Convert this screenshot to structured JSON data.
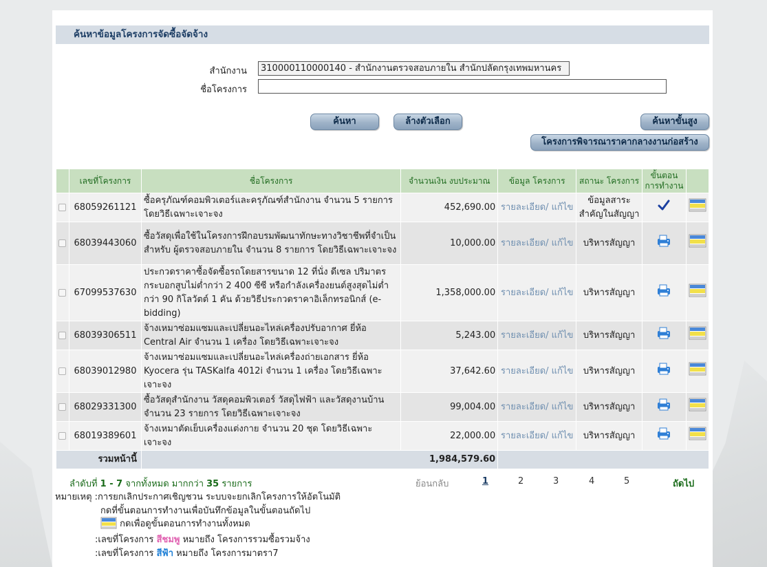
{
  "header": {
    "title": "ค้นหาข้อมูลโครงการจัดซื้อจัดจ้าง"
  },
  "form": {
    "agency_label": "สำนักงาน",
    "agency_value": "310000110000140 - สำนักงานตรวจสอบภายใน สำนักปลัดกรุงเทพมหานคร",
    "project_name_label": "ชื่อโครงการ",
    "project_name_value": ""
  },
  "buttons": {
    "search": "ค้นหา",
    "clear": "ล้างตัวเลือก",
    "advanced": "ค้นหาขั้นสูง",
    "construction": "โครงการพิจารณาราคากลางงานก่อสร้าง"
  },
  "table": {
    "headers": {
      "project_no": "เลขที่โครงการ",
      "project_name": "ชื่อโครงการ",
      "budget": "จำนวนเงิน งบประมาณ",
      "info": "ข้อมูล โครงการ",
      "status": "สถานะ โครงการ",
      "step": "ขั้นตอน การทำงาน"
    },
    "rows": [
      {
        "no": "68059261121",
        "name": "ซื้อครุภัณฑ์คอมพิวเตอร์และครุภัณฑ์สำนักงาน จำนวน 5 รายการ โดยวิธีเฉพาะเจาะจง",
        "budget": "452,690.00",
        "info": "รายละเอียด/ แก้ไข",
        "status": "ข้อมูลสาระ สำคัญในสัญญา",
        "step_icon": "checkmark-icon"
      },
      {
        "no": "68039443060",
        "name": "ซื้อวัสดุเพื่อใช้ในโครงการฝึกอบรมพัฒนาทักษะทางวิชาชีพที่จำเป็นสำหรับ ผู้ตรวจสอบภายใน จำนวน 8 รายการ โดยวิธีเฉพาะเจาะจง",
        "budget": "10,000.00",
        "info": "รายละเอียด/ แก้ไข",
        "status": "บริหารสัญญา",
        "step_icon": "printer-icon"
      },
      {
        "no": "67099537630",
        "name": "ประกวดราคาซื้อจัดซื้อรถโดยสารขนาด 12 ที่นั่ง ดีเซล ปริมาตรกระบอกสูบไม่ต่ำกว่า 2 400 ซีซี หรือกำลังเครื่องยนต์สูงสุดไม่ต่ำกว่า 90 กิโลวัตต์ 1 คัน ด้วยวิธีประกวดราคาอิเล็กทรอนิกส์ (e-bidding)",
        "budget": "1,358,000.00",
        "info": "รายละเอียด/ แก้ไข",
        "status": "บริหารสัญญา",
        "step_icon": "printer-icon"
      },
      {
        "no": "68039306511",
        "name": "จ้างเหมาซ่อมแซมและเปลี่ยนอะไหล่เครื่องปรับอากาศ ยี่ห้อ Central Air จำนวน 1 เครื่อง โดยวิธีเฉพาะเจาะจง",
        "budget": "5,243.00",
        "info": "รายละเอียด/ แก้ไข",
        "status": "บริหารสัญญา",
        "step_icon": "printer-icon"
      },
      {
        "no": "68039012980",
        "name": "จ้างเหมาซ่อมแซมและเปลี่ยนอะไหล่เครื่องถ่ายเอกสาร ยี่ห้อ Kyocera รุ่น TASKalfa 4012i จำนวน 1 เครื่อง โดยวิธีเฉพาะเจาะจง",
        "budget": "37,642.60",
        "info": "รายละเอียด/ แก้ไข",
        "status": "บริหารสัญญา",
        "step_icon": "printer-icon"
      },
      {
        "no": "68029331300",
        "name": "ซื้อวัสดุสำนักงาน วัสดุคอมพิวเตอร์ วัสดุไฟฟ้า และวัสดุงานบ้าน จำนวน 23 รายการ โดยวิธีเฉพาะเจาะจง",
        "budget": "99,004.00",
        "info": "รายละเอียด/ แก้ไข",
        "status": "บริหารสัญญา",
        "step_icon": "printer-icon"
      },
      {
        "no": "68019389601",
        "name": "จ้างเหมาตัดเย็บเครื่องแต่งกาย จำนวน 20 ชุด โดยวิธีเฉพาะเจาะจง",
        "budget": "22,000.00",
        "info": "รายละเอียด/ แก้ไข",
        "status": "บริหารสัญญา",
        "step_icon": "printer-icon"
      }
    ],
    "total_label": "รวมหน้านี้",
    "total_value": "1,984,579.60"
  },
  "pagination": {
    "summary_prefix": "ลำดับที่",
    "summary_range": "1 - 7",
    "summary_mid": "จากทั้งหมด มากกว่า",
    "summary_count": "35",
    "summary_suffix": "รายการ",
    "back": "ย้อนกลับ",
    "pages": [
      "1",
      "2",
      "3",
      "4",
      "5"
    ],
    "current": "1",
    "next": "ถัดไป"
  },
  "notes": {
    "label": "หมายเหตุ :",
    "line1": "การยกเลิกประกาศเชิญชวน ระบบจะยกเลิกโครงการให้อัตโนมัติ",
    "line2": "กดที่ขั้นตอนการทำงานเพื่อบันทึกข้อมูลในขั้นตอนถัดไป",
    "line3": "กดเพื่อดูขั้นตอนการทำงานทั้งหมด",
    "line4_prefix": ":เลขที่โครงการ",
    "line4_color_word": "สีชมพู",
    "line4_suffix": "หมายถึง โครงการรวมซื้อรวมจ้าง",
    "line5_prefix": ":เลขที่โครงการ",
    "line5_color_word": "สีฟ้า",
    "line5_suffix": "หมายถึง โครงการมาตรา7"
  },
  "colors": {
    "pink_note": "#e060b0",
    "blue_note": "#1e7fd6",
    "header_bg": "#d6dde5",
    "table_head_bg": "#c8dfc0"
  }
}
